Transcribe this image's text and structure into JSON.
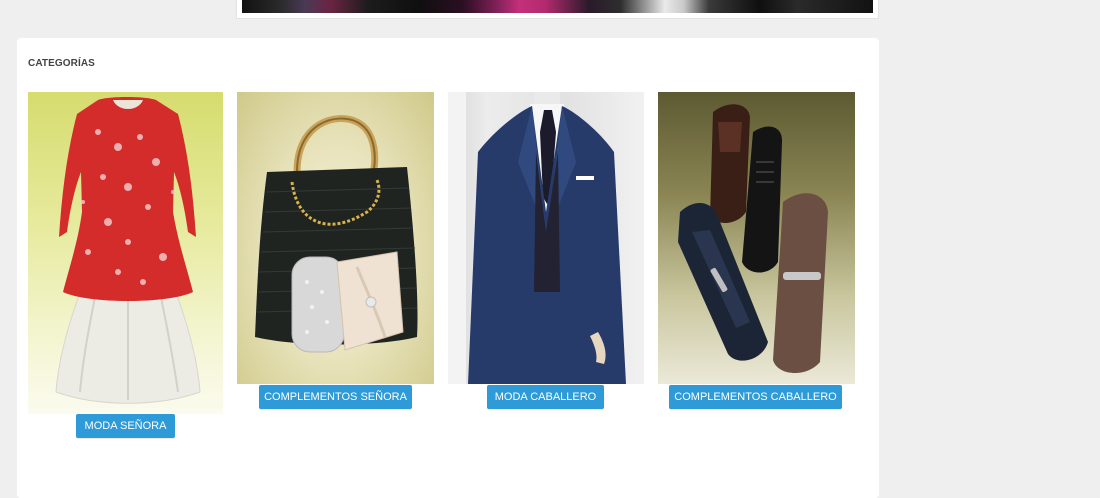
{
  "header": {
    "banner_alt": "top banner"
  },
  "categories": {
    "title": "CATEGORÍAS",
    "items": [
      {
        "label": "MODA SEÑORA",
        "image": "dress-image"
      },
      {
        "label": "COMPLEMENTOS SEÑORA",
        "image": "handbag-image"
      },
      {
        "label": "MODA CABALLERO",
        "image": "suit-image"
      },
      {
        "label": "COMPLEMENTOS CABALLERO",
        "image": "shoes-image"
      }
    ]
  },
  "colors": {
    "page_bg": "#efefef",
    "panel_bg": "#ffffff",
    "button_bg": "#2e9ad8",
    "button_text": "#ffffff",
    "title_text": "#444444"
  }
}
